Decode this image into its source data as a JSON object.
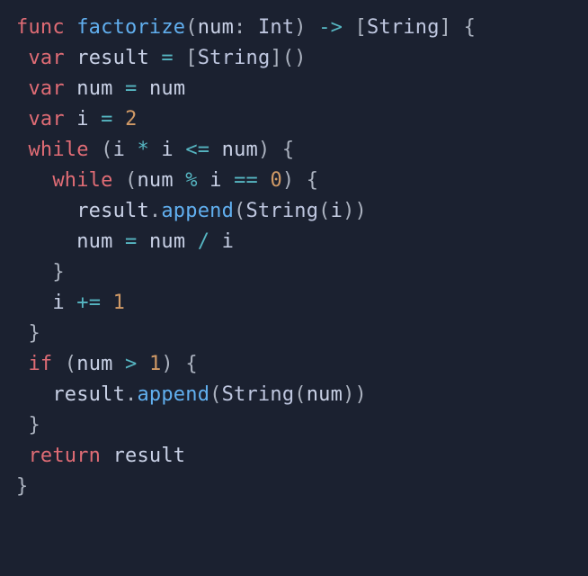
{
  "code": {
    "kw_func": "func",
    "fn_name": "factorize",
    "param_name": "num",
    "type_Int": "Int",
    "arrow": "->",
    "type_String": "String",
    "kw_var": "var",
    "id_result": "result",
    "id_num": "num",
    "id_i": "i",
    "kw_while": "while",
    "kw_if": "if",
    "kw_return": "return",
    "fn_append": "append",
    "lit_2": "2",
    "lit_0": "0",
    "lit_1_a": "1",
    "lit_1_b": "1",
    "op_eq": "=",
    "op_star": "*",
    "op_le": "<=",
    "op_mod": "%",
    "op_eqeq": "==",
    "op_div": "/",
    "op_pluseq": "+=",
    "op_gt": ">"
  }
}
